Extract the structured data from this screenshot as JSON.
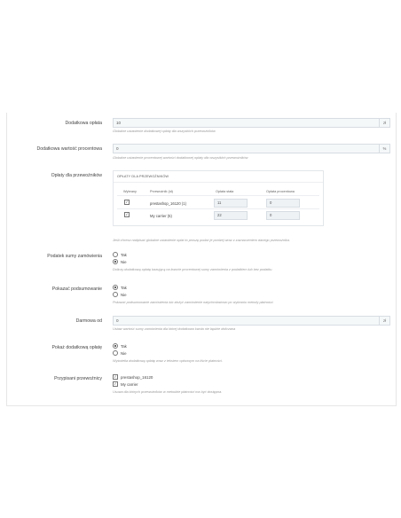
{
  "form": {
    "additional_fee": {
      "label": "Dodatkowa opłata",
      "value": "10",
      "addon": "zł",
      "help": "Globalne ustawienie dodatkowej opłaty dla wszystkich przewoźników"
    },
    "additional_percent": {
      "label": "Dodatkowa wartość procentowa",
      "value": "0",
      "addon": "%",
      "help": "Globalne ustawienie procentowej wartości dodatkowej opłaty dla wszystkich przewoźników"
    },
    "carrier_fees": {
      "label": "Opłaty dla przewoźników",
      "panel_title": "OPŁATY DLA PRZEWOŹNIKÓW",
      "headers": [
        "Wybrany",
        "Przewoźnik (id)",
        "Opłata stała",
        "Opłata procentowa"
      ],
      "rows": [
        {
          "checked": true,
          "name": "prestashop_16120 (1)",
          "fixed": "11",
          "percent": "0"
        },
        {
          "checked": true,
          "name": "My carrier (5)",
          "fixed": "22",
          "percent": "0"
        }
      ],
      "help": "Jeśli chcesz nadpisać globalne ustawienie opłat to proszę podać je poniżej wraz z zaznaczeniem danego przewoźnika."
    },
    "order_tax": {
      "label": "Podatek sumy zamówienia",
      "options": [
        {
          "label": "Tak",
          "selected": false
        },
        {
          "label": "Nie",
          "selected": true
        }
      ],
      "help": "Doliczy dodatkową opłatę bazującą na kwocie procentowej sumy zamówienia z podatkiem lub bez podatku."
    },
    "show_summary": {
      "label": "Pokazać podsumowanie",
      "options": [
        {
          "label": "Tak",
          "selected": true
        },
        {
          "label": "Nie",
          "selected": false
        }
      ],
      "help": "Pokazać podsumowanie zamówienia lub złożyć zamówienie natychmiastowo po wybraniu metody płatności."
    },
    "free_from": {
      "label": "Darmowa od",
      "value": "0",
      "addon": "zł",
      "help": "Ustaw wartość sumy zamówienia dla której dodatkowa kwota nie będzie doliczana"
    },
    "show_fee": {
      "label": "Pokaż dodatkową opłatę",
      "options": [
        {
          "label": "Tak",
          "selected": true
        },
        {
          "label": "Nie",
          "selected": false
        }
      ],
      "help": "Wyświetla dodatkową opłatę wraz z tekstem opisowym na liście płatności."
    },
    "assigned_carriers": {
      "label": "Przypisani przewoźnicy",
      "options": [
        {
          "label": "prestashop_16120",
          "checked": true
        },
        {
          "label": "My carrier",
          "checked": true
        }
      ],
      "help": "Usuwa dla których przewoźników w metodzie płatności ma być dostępna."
    }
  }
}
